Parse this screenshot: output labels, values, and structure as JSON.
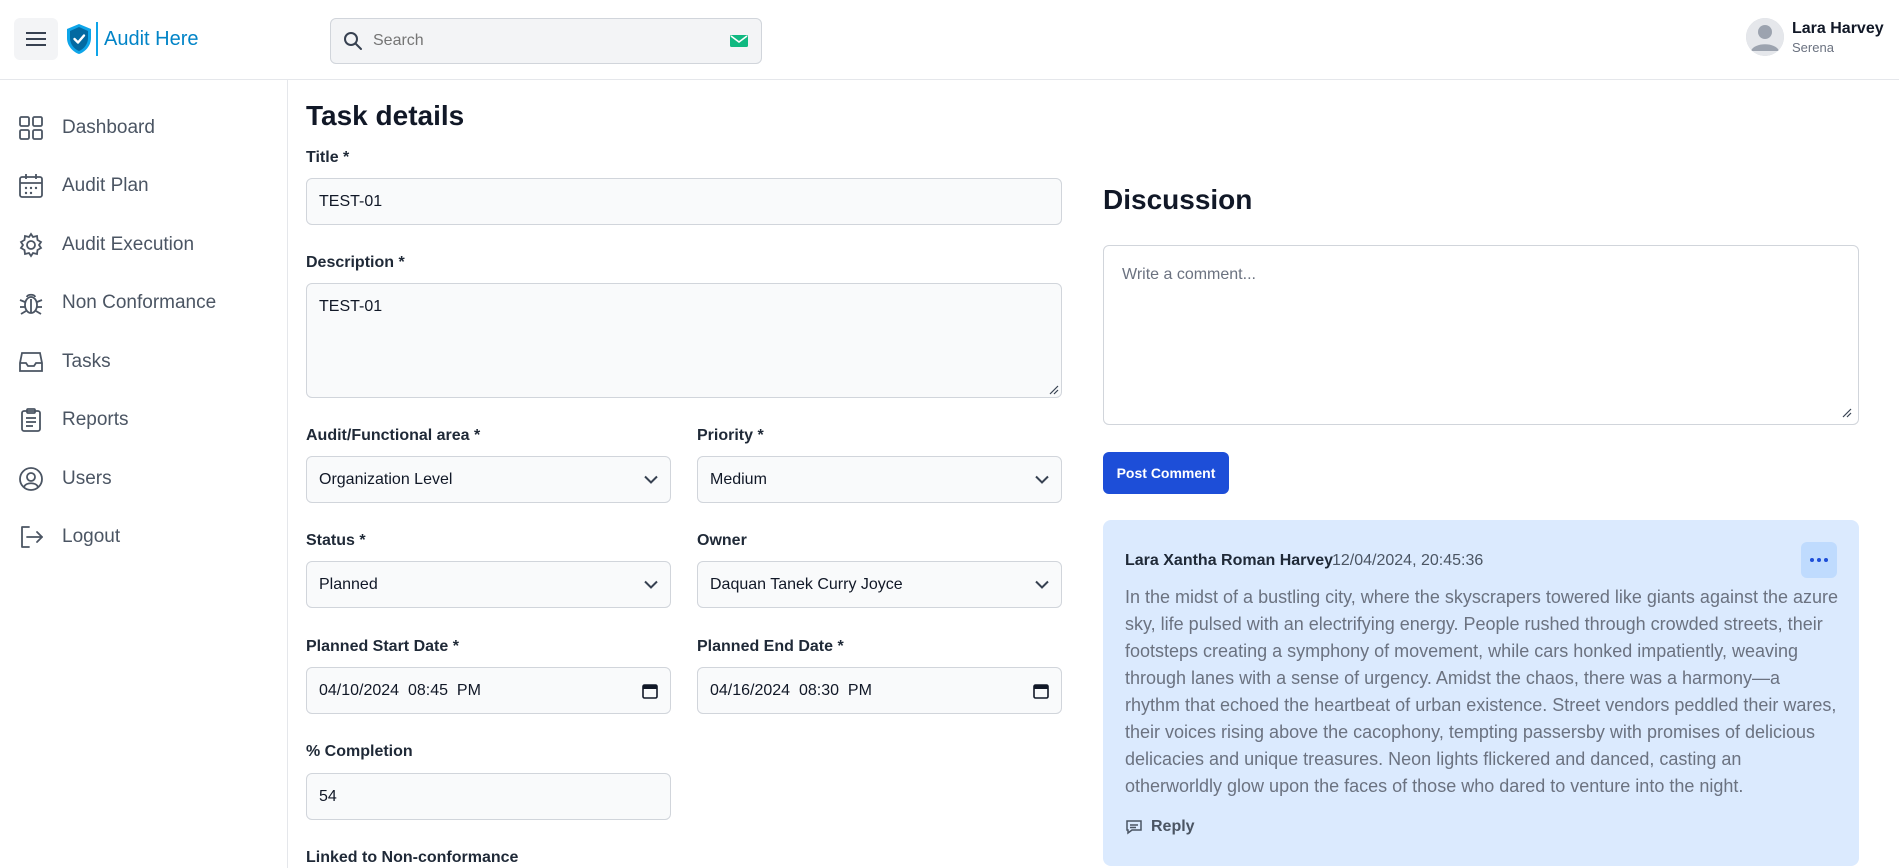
{
  "app": {
    "name": "Audit Here"
  },
  "header": {
    "search_placeholder": "Search"
  },
  "user": {
    "name": "Lara Harvey",
    "role": "Serena"
  },
  "sidebar": {
    "items": [
      {
        "label": "Dashboard",
        "icon": "dashboard-icon"
      },
      {
        "label": "Audit Plan",
        "icon": "calendar-icon"
      },
      {
        "label": "Audit Execution",
        "icon": "gear-icon"
      },
      {
        "label": "Non Conformance",
        "icon": "bug-icon"
      },
      {
        "label": "Tasks",
        "icon": "inbox-icon"
      },
      {
        "label": "Reports",
        "icon": "clipboard-icon"
      },
      {
        "label": "Users",
        "icon": "user-circle-icon"
      },
      {
        "label": "Logout",
        "icon": "logout-icon"
      }
    ]
  },
  "task": {
    "page_title": "Task details",
    "title_label": "Title *",
    "title_value": "TEST-01",
    "description_label": "Description *",
    "description_value": "TEST-01",
    "area_label": "Audit/Functional area *",
    "area_value": "Organization Level",
    "priority_label": "Priority *",
    "priority_value": "Medium",
    "status_label": "Status *",
    "status_value": "Planned",
    "owner_label": "Owner",
    "owner_value": "Daquan Tanek Curry Joyce",
    "start_label": "Planned Start Date *",
    "start_value": "04/10/2024  08:45  PM",
    "end_label": "Planned End Date *",
    "end_value": "04/16/2024  08:30  PM",
    "completion_label": "% Completion",
    "completion_value": "54",
    "linked_label": "Linked to Non-conformance"
  },
  "discussion": {
    "title": "Discussion",
    "comment_placeholder": "Write a comment...",
    "post_label": "Post Comment",
    "comments": [
      {
        "author": "Lara Xantha Roman Harvey",
        "date": "12/04/2024, 20:45:36",
        "body": "In the midst of a bustling city, where the skyscrapers towered like giants against the azure sky, life pulsed with an electrifying energy. People rushed through crowded streets, their footsteps creating a symphony of movement, while cars honked impatiently, weaving through lanes with a sense of urgency. Amidst the chaos, there was a harmony—a rhythm that echoed the heartbeat of urban existence. Street vendors peddled their wares, their voices rising above the cacophony, tempting passersby with promises of delicious delicacies and unique treasures. Neon lights flickered and danced, casting an otherworldly glow upon the faces of those who dared to venture into the night.",
        "reply_label": "Reply"
      }
    ]
  },
  "colors": {
    "accent": "#1d4ed8",
    "brand": "#0284c7",
    "comment_bg": "#dbeafe"
  }
}
